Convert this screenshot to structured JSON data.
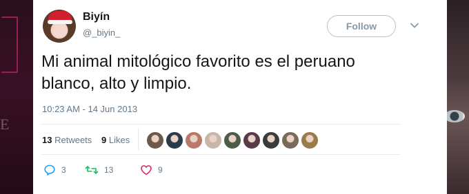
{
  "tweet": {
    "author": {
      "name": "Biyín",
      "handle": "@_biyin_"
    },
    "follow_label": "Follow",
    "text_lines": [
      "Mi animal mitológico favorito es el peruano",
      "blanco, alto y limpio."
    ],
    "timestamp": "10:23 AM - 14 Jun 2013",
    "stats": {
      "retweets_count": "13",
      "retweets_label": "Retweets",
      "likes_count": "9",
      "likes_label": "Likes"
    },
    "liker_avatars_count": 9,
    "actions": {
      "reply_count": "3",
      "retweet_count": "13",
      "like_count": "9"
    }
  },
  "icons": {
    "reply": "reply-icon",
    "retweet": "retweet-icon",
    "like": "heart-icon",
    "more": "chevron-down-icon"
  },
  "colors": {
    "text_primary": "#14171a",
    "text_secondary": "#657786",
    "divider": "#e6ecf0",
    "follow_border": "#b7c3cc"
  }
}
